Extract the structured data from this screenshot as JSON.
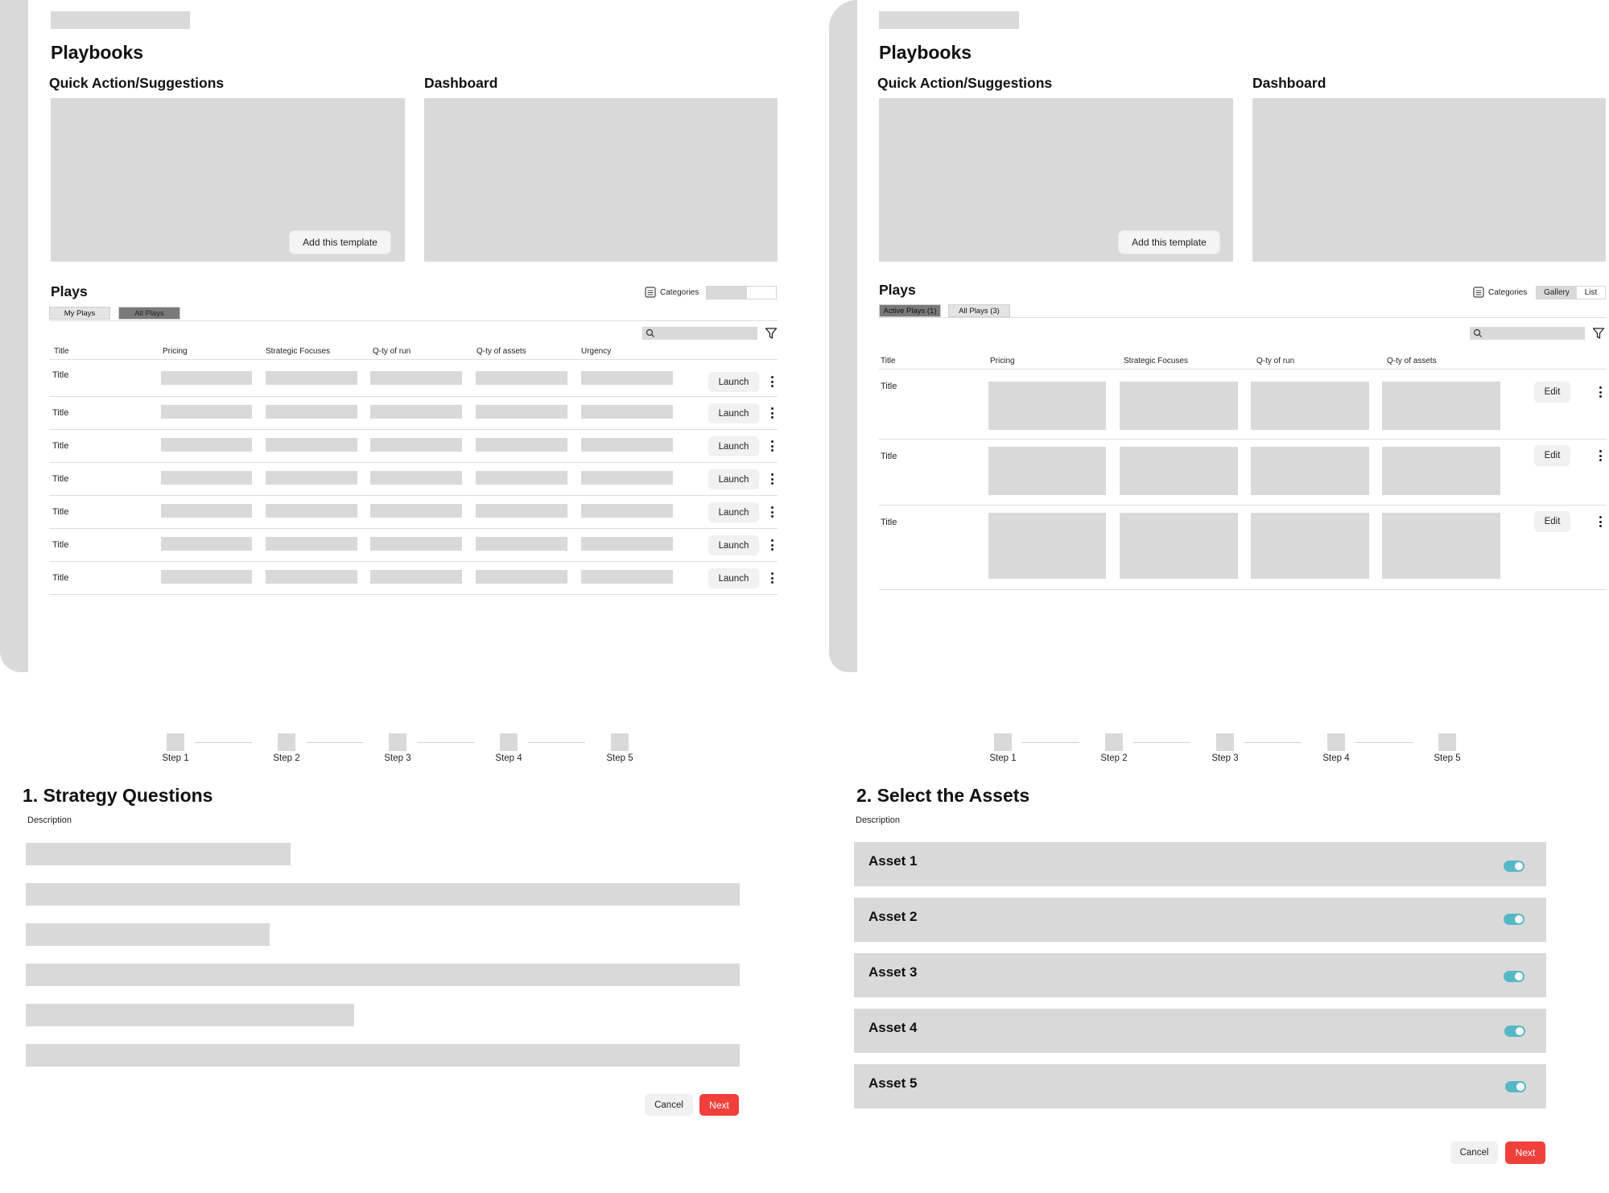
{
  "panel_list": {
    "title": "Playbooks",
    "quick_action_heading": "Quick Action/Suggestions",
    "dashboard_heading": "Dashboard",
    "add_template_label": "Add this template",
    "plays_heading": "Plays",
    "categories_label": "Categories",
    "tabs": [
      "My Plays",
      "All Plays"
    ],
    "columns": [
      "Title",
      "Pricing",
      "Strategic Focuses",
      "Q-ty of run",
      "Q-ty of assets",
      "Urgency"
    ],
    "rows": [
      "Title",
      "Title",
      "Title",
      "Title",
      "Title",
      "Title",
      "Title"
    ],
    "row_action_label": "Launch"
  },
  "panel_gallery": {
    "title": "Playbooks",
    "quick_action_heading": "Quick Action/Suggestions",
    "dashboard_heading": "Dashboard",
    "add_template_label": "Add this template",
    "plays_heading": "Plays",
    "categories_label": "Categories",
    "view_toggle": [
      "Gallery",
      "List"
    ],
    "tabs": [
      "Active Plays (1)",
      "All Plays (3)"
    ],
    "columns": [
      "Title",
      "Pricing",
      "Strategic Focuses",
      "Q-ty of run",
      "Q-ty of assets"
    ],
    "rows": [
      "Title",
      "Title",
      "Title"
    ],
    "row_action_label": "Edit"
  },
  "wizard_strategy": {
    "steps": [
      "Step 1",
      "Step 2",
      "Step 3",
      "Step 4",
      "Step 5"
    ],
    "title": "1. Strategy Questions",
    "description": "Description",
    "cancel_label": "Cancel",
    "next_label": "Next"
  },
  "wizard_assets": {
    "steps": [
      "Step 1",
      "Step 2",
      "Step 3",
      "Step 4",
      "Step 5"
    ],
    "title": "2. Select the Assets",
    "description": "Description",
    "assets": [
      {
        "label": "Asset 1",
        "enabled": true
      },
      {
        "label": "Asset 2",
        "enabled": true
      },
      {
        "label": "Asset 3",
        "enabled": true
      },
      {
        "label": "Asset 4",
        "enabled": true
      },
      {
        "label": "Asset 5",
        "enabled": true
      }
    ],
    "cancel_label": "Cancel",
    "next_label": "Next"
  },
  "colors": {
    "placeholder": "#d9d9d9",
    "accent_red": "#f0403c",
    "toggle_on": "#56b8c6",
    "tab_active": "#7a7a7a"
  },
  "icons": [
    "search-icon",
    "filter-icon",
    "categories-icon",
    "kebab-menu-icon"
  ]
}
